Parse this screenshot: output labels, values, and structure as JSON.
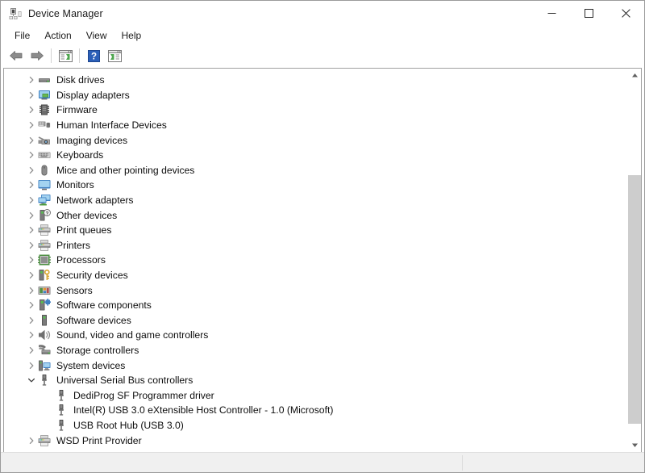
{
  "window": {
    "title": "Device Manager",
    "icon": "device-manager-icon",
    "controls": [
      {
        "name": "minimize-button",
        "glyph": "minimize"
      },
      {
        "name": "maximize-button",
        "glyph": "maximize"
      },
      {
        "name": "close-button",
        "glyph": "close"
      }
    ]
  },
  "menubar": {
    "items": [
      {
        "label": "File"
      },
      {
        "label": "Action"
      },
      {
        "label": "View"
      },
      {
        "label": "Help"
      }
    ]
  },
  "toolbar": {
    "buttons": [
      {
        "name": "back-button",
        "icon": "back-arrow-icon"
      },
      {
        "name": "forward-button",
        "icon": "forward-arrow-icon"
      },
      {
        "name": "show-hide-console-tree-button",
        "icon": "console-tree-icon"
      },
      {
        "name": "help-button",
        "icon": "help-question-icon"
      },
      {
        "name": "show-hide-action-pane-button",
        "icon": "action-pane-icon"
      }
    ]
  },
  "tree": {
    "items": [
      {
        "label": "Disk drives",
        "depth": 1,
        "expanded": false,
        "icon": "disk-drive-icon"
      },
      {
        "label": "Display adapters",
        "depth": 1,
        "expanded": false,
        "icon": "display-adapter-icon"
      },
      {
        "label": "Firmware",
        "depth": 1,
        "expanded": false,
        "icon": "firmware-chip-icon"
      },
      {
        "label": "Human Interface Devices",
        "depth": 1,
        "expanded": false,
        "icon": "hid-icon"
      },
      {
        "label": "Imaging devices",
        "depth": 1,
        "expanded": false,
        "icon": "imaging-device-icon"
      },
      {
        "label": "Keyboards",
        "depth": 1,
        "expanded": false,
        "icon": "keyboard-icon"
      },
      {
        "label": "Mice and other pointing devices",
        "depth": 1,
        "expanded": false,
        "icon": "mouse-icon"
      },
      {
        "label": "Monitors",
        "depth": 1,
        "expanded": false,
        "icon": "monitor-icon"
      },
      {
        "label": "Network adapters",
        "depth": 1,
        "expanded": false,
        "icon": "network-adapter-icon"
      },
      {
        "label": "Other devices",
        "depth": 1,
        "expanded": false,
        "icon": "other-device-icon"
      },
      {
        "label": "Print queues",
        "depth": 1,
        "expanded": false,
        "icon": "printer-icon"
      },
      {
        "label": "Printers",
        "depth": 1,
        "expanded": false,
        "icon": "printer-icon"
      },
      {
        "label": "Processors",
        "depth": 1,
        "expanded": false,
        "icon": "processor-icon"
      },
      {
        "label": "Security devices",
        "depth": 1,
        "expanded": false,
        "icon": "security-device-icon"
      },
      {
        "label": "Sensors",
        "depth": 1,
        "expanded": false,
        "icon": "sensor-icon"
      },
      {
        "label": "Software components",
        "depth": 1,
        "expanded": false,
        "icon": "software-component-icon"
      },
      {
        "label": "Software devices",
        "depth": 1,
        "expanded": false,
        "icon": "software-device-icon"
      },
      {
        "label": "Sound, video and game controllers",
        "depth": 1,
        "expanded": false,
        "icon": "sound-speaker-icon"
      },
      {
        "label": "Storage controllers",
        "depth": 1,
        "expanded": false,
        "icon": "storage-controller-icon"
      },
      {
        "label": "System devices",
        "depth": 1,
        "expanded": false,
        "icon": "system-device-icon"
      },
      {
        "label": "Universal Serial Bus controllers",
        "depth": 1,
        "expanded": true,
        "icon": "usb-icon"
      },
      {
        "label": "DediProg SF Programmer driver",
        "depth": 2,
        "expanded": null,
        "icon": "usb-icon"
      },
      {
        "label": "Intel(R) USB 3.0 eXtensible Host Controller - 1.0 (Microsoft)",
        "depth": 2,
        "expanded": null,
        "icon": "usb-icon"
      },
      {
        "label": "USB Root Hub (USB 3.0)",
        "depth": 2,
        "expanded": null,
        "icon": "usb-icon"
      },
      {
        "label": "WSD Print Provider",
        "depth": 1,
        "expanded": false,
        "icon": "printer-icon"
      }
    ]
  },
  "scrollbar": {
    "up_arrow": "scroll-up-arrow-icon",
    "down_arrow": "scroll-down-arrow-icon",
    "thumb_top_pct": 26,
    "thumb_height_pct": 70
  },
  "statusbar": {
    "text": ""
  },
  "colors": {
    "window_bg": "#ffffff",
    "border": "#9b9b9b",
    "statusbar_bg": "#f0f0f0",
    "scroll_thumb": "#cdcdcd",
    "text": "#0d0d0d",
    "accent_blue": "#2a6fd6"
  }
}
